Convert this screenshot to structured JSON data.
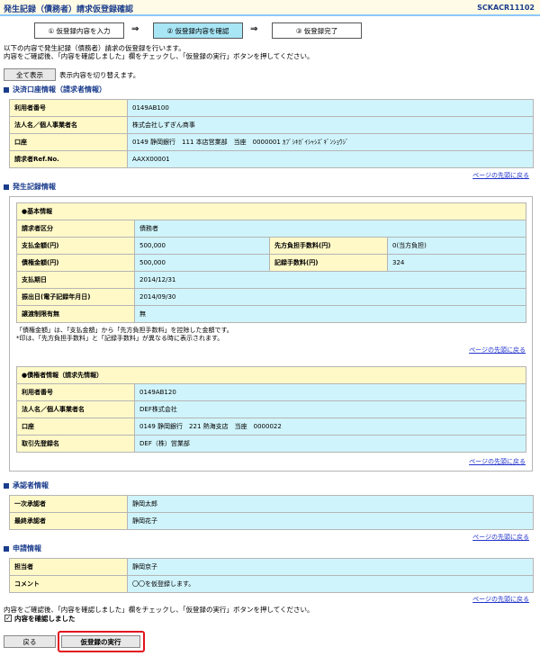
{
  "header": {
    "title": "発生記録（債務者）請求仮登録確認",
    "screen_code": "SCKACR11102"
  },
  "steps": [
    {
      "label": "① 仮登録内容を入力"
    },
    {
      "label": "② 仮登録内容を確認"
    },
    {
      "label": "③ 仮登録完了"
    }
  ],
  "arrow": "⇒",
  "intro": {
    "line1": "以下の内容で発生記録（債務者）請求の仮登録を行います。",
    "line2": "内容をご確認後、「内容を確認しました」欄をチェックし、「仮登録の実行」ボタンを押してください。"
  },
  "display_all": {
    "button": "全て表示",
    "caption": "表示内容を切り替えます。"
  },
  "to_top_link": "ページの先頭に戻る",
  "settlement": {
    "title": "決済口座情報（請求者情報）",
    "rows": [
      {
        "label": "利用者番号",
        "value": "0149AB100"
      },
      {
        "label": "法人名／個人事業者名",
        "value": "株式会社しずぎん商事"
      },
      {
        "label": "口座",
        "value": "0149 静岡銀行　111 本店営業部　当座　0000001 ｶﾌﾞｼｷｶﾞｲｼｬｼｽﾞｷﾞﾝｼｮｳｼﾞ"
      },
      {
        "label": "請求者Ref.No.",
        "value": "AAXX00001"
      }
    ]
  },
  "occurrence": {
    "title": "発生記録情報",
    "basic": {
      "header": "●基本情報",
      "debtor_label": "請求者区分",
      "debtor_value": "債務者",
      "pay_label": "支払金額(円)",
      "pay_value": "500,000",
      "fee_label": "先方負担手数料(円)",
      "fee_value": "0(当方負担)",
      "claim_label": "債権金額(円)",
      "claim_value": "500,000",
      "record_fee_label": "記録手数料(円)",
      "record_fee_value": "324",
      "due_label": "支払期日",
      "due_value": "2014/12/31",
      "issue_label": "振出日(電子記録年月日)",
      "issue_value": "2014/09/30",
      "transfer_label": "譲渡制限有無",
      "transfer_value": "無",
      "note1": "「債権金額」は、「支払金額」から「先方負担手数料」を控除した金額です。",
      "note2": "*印は、「先方負担手数料」と「記録手数料」が異なる時に表示されます。"
    },
    "creditor": {
      "header": "●債権者情報（請求先情報）",
      "rows": [
        {
          "label": "利用者番号",
          "value": "0149AB120"
        },
        {
          "label": "法人名／個人事業者名",
          "value": "DEF株式会社"
        },
        {
          "label": "口座",
          "value": "0149 静岡銀行　221 熱海支店　当座　0000022"
        },
        {
          "label": "取引先登録名",
          "value": "DEF（株）営業部"
        }
      ]
    }
  },
  "approver": {
    "title": "承認者情報",
    "rows": [
      {
        "label": "一次承認者",
        "value": "静岡太郎"
      },
      {
        "label": "最終承認者",
        "value": "静岡花子"
      }
    ]
  },
  "application": {
    "title": "申請情報",
    "rows": [
      {
        "label": "担当者",
        "value": "静岡京子"
      },
      {
        "label": "コメント",
        "value": "〇〇を仮登録します。"
      }
    ]
  },
  "footer": {
    "instruction": "内容をご確認後、「内容を確認しました」欄をチェックし、「仮登録の実行」ボタンを押してください。",
    "confirm_label": "内容を確認しました",
    "back_button": "戻る",
    "execute_button": "仮登録の実行"
  },
  "colors": {
    "label_bg": "#fff9c8",
    "value_bg": "#d0f4fb",
    "title": "#1a3c8c",
    "highlight": "#e0141e"
  }
}
